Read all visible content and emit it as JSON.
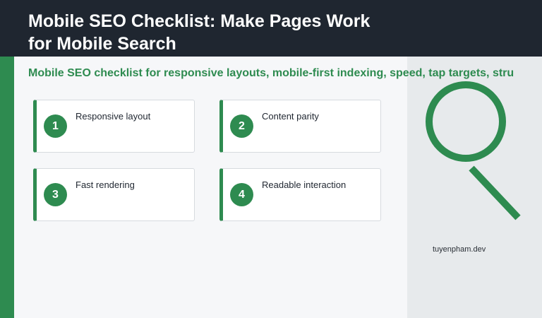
{
  "header": {
    "title": "Mobile SEO Checklist: Make Pages Work for Mobile Search"
  },
  "subtitle": "Mobile SEO checklist for responsive layouts, mobile-first indexing, speed, tap targets, stru",
  "cards": [
    {
      "number": "1",
      "label": "Responsive layout"
    },
    {
      "number": "2",
      "label": "Content parity"
    },
    {
      "number": "3",
      "label": "Fast rendering"
    },
    {
      "number": "4",
      "label": "Readable interaction"
    }
  ],
  "graphic": {
    "icon": "magnifier-icon",
    "color": "#2e8b50"
  },
  "footer": {
    "domain": "tuyenpham.dev"
  },
  "colors": {
    "accent": "#2e8b50",
    "header_bg": "#1f2630",
    "page_bg": "#f6f7f9",
    "panel_bg": "#e7eaec"
  }
}
